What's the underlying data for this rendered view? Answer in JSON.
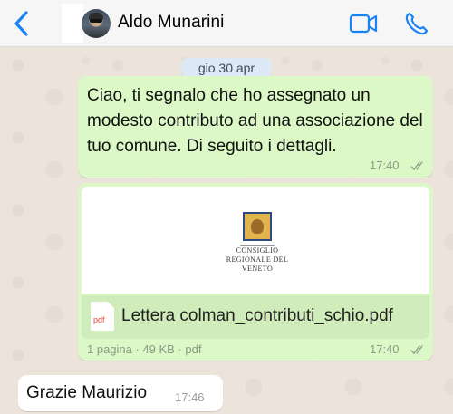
{
  "header": {
    "contact_name": "Aldo Munarini",
    "accent_color": "#1a82f7"
  },
  "date_separator": "gio 30 apr",
  "messages": [
    {
      "direction": "outgoing",
      "text": "Ciao, ti segnalo che ho assegnato un modesto contributo ad una associazione del tuo comune. Di seguito i dettagli.",
      "time": "17:40",
      "status": "read"
    },
    {
      "direction": "outgoing",
      "type": "document",
      "preview_org": "CONSIGLIO REGIONALE DEL VENETO",
      "file_type_label": "pdf",
      "file_name": "Lettera colman_contributi_schio.pdf",
      "file_info": "1 pagina · 49 KB · pdf",
      "time": "17:40",
      "status": "read"
    },
    {
      "direction": "incoming",
      "text": "Grazie Maurizio",
      "time": "17:46"
    }
  ],
  "colors": {
    "outgoing_bubble": "#dcf8c6",
    "incoming_bubble": "#ffffff",
    "date_pill": "#dde9f7"
  }
}
